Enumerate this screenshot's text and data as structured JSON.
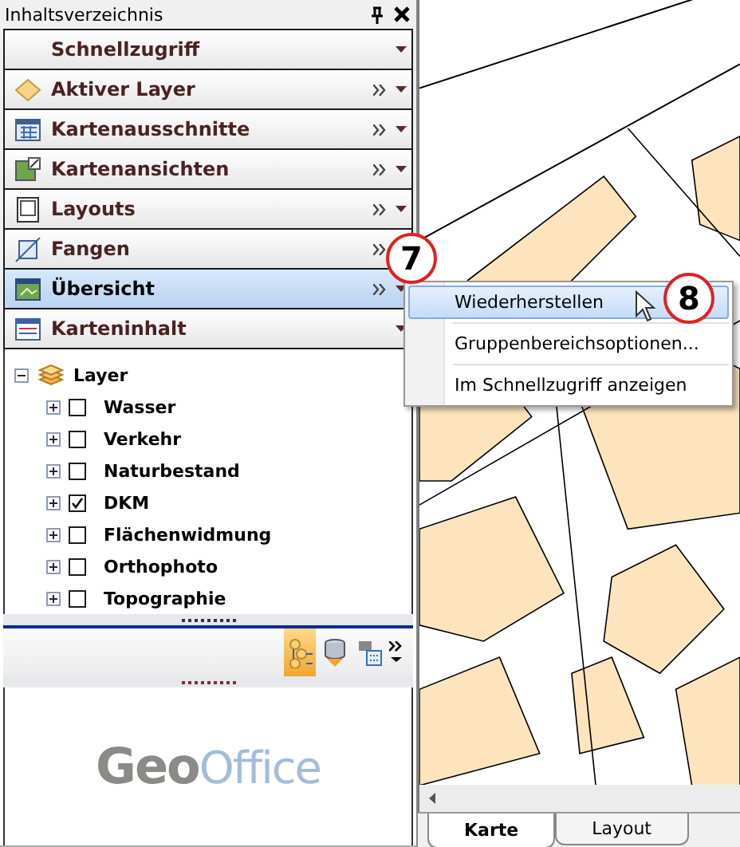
{
  "panel": {
    "title": "Inhaltsverzeichnis"
  },
  "groups": [
    {
      "label": "Schnellzugriff",
      "overflow": false,
      "selected": false
    },
    {
      "label": "Aktiver Layer",
      "overflow": true,
      "selected": false
    },
    {
      "label": "Kartenausschnitte",
      "overflow": true,
      "selected": false
    },
    {
      "label": "Kartenansichten",
      "overflow": true,
      "selected": false
    },
    {
      "label": "Layouts",
      "overflow": true,
      "selected": false
    },
    {
      "label": "Fangen",
      "overflow": true,
      "selected": false
    },
    {
      "label": "Übersicht",
      "overflow": true,
      "selected": true
    },
    {
      "label": "Karteninhalt",
      "overflow": false,
      "selected": false
    }
  ],
  "tree": {
    "label": "Layer",
    "expanded": true,
    "children": [
      {
        "label": "Wasser",
        "checked": false,
        "expanded": false
      },
      {
        "label": "Verkehr",
        "checked": false,
        "expanded": false
      },
      {
        "label": "Naturbestand",
        "checked": false,
        "expanded": false
      },
      {
        "label": "DKM",
        "checked": true,
        "expanded": false
      },
      {
        "label": "Flächenwidmung",
        "checked": false,
        "expanded": false
      },
      {
        "label": "Orthophoto",
        "checked": false,
        "expanded": false
      },
      {
        "label": "Topographie",
        "checked": false,
        "expanded": false
      }
    ]
  },
  "toolbar": [
    {
      "selected": true
    },
    {
      "selected": false
    },
    {
      "selected": false
    }
  ],
  "logo": {
    "primary": "Geo",
    "secondary": "Office"
  },
  "context_menu": {
    "items": [
      {
        "label": "Wiederherstellen",
        "selected": true
      },
      {
        "label": "Gruppenbereichsoptionen...",
        "selected": false
      },
      {
        "label": "Im Schnellzugriff anzeigen",
        "selected": false
      }
    ]
  },
  "callouts": [
    "7",
    "8"
  ],
  "tabs": [
    {
      "label": "Karte",
      "selected": true
    },
    {
      "label": "Layout",
      "selected": false
    }
  ]
}
